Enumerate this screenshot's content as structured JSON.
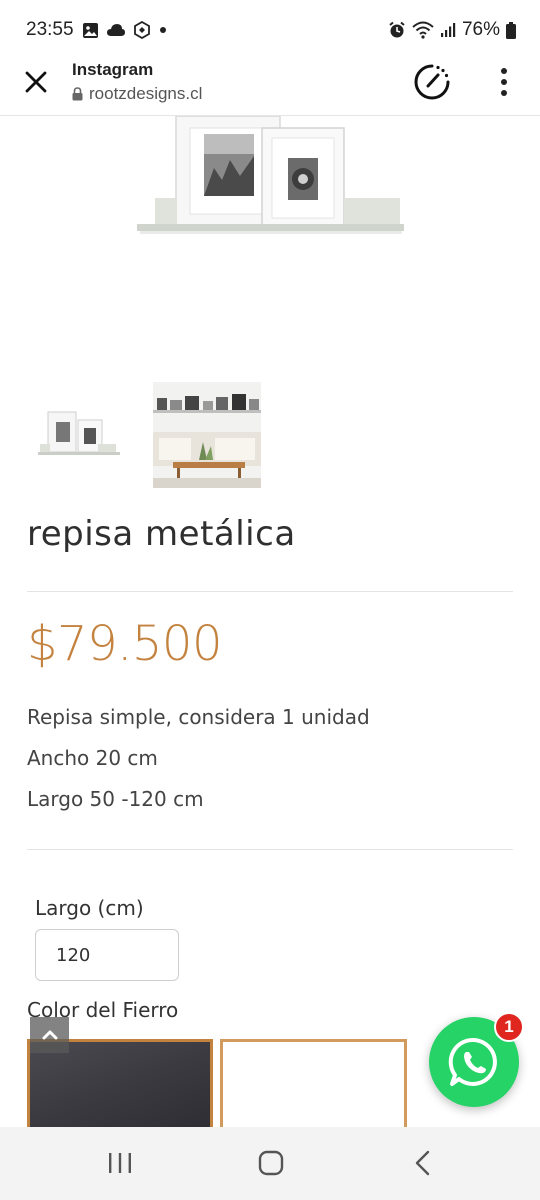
{
  "status_bar": {
    "time": "23:55",
    "battery": "76%",
    "left_icons": [
      "gallery-icon",
      "cloud-icon",
      "ai-icon",
      "dot-icon"
    ],
    "right_icons": [
      "alarm-icon",
      "wifi-icon",
      "signal-icon",
      "battery-icon"
    ]
  },
  "browser": {
    "title": "Instagram",
    "url": "rootzdesigns.cl"
  },
  "product": {
    "title": "repisa metálica",
    "price": "$79.500",
    "description": [
      "Repisa simple, considera 1 unidad",
      "Ancho 20 cm",
      "Largo 50 -120 cm"
    ]
  },
  "options": {
    "length_label": "Largo (cm)",
    "length_value": "120",
    "color_label": "Color del Fierro",
    "swatches": [
      {
        "name": "dark",
        "color": "#3b3a40"
      },
      {
        "name": "white",
        "color": "#ffffff"
      }
    ],
    "accent_color": "#c4823f"
  },
  "whatsapp": {
    "badge_count": "1",
    "color": "#25d366"
  }
}
